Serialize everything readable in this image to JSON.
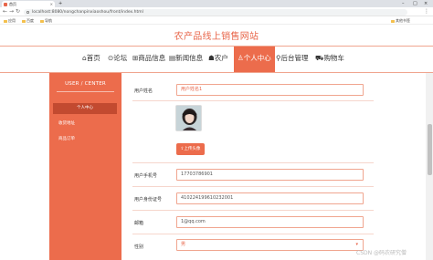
{
  "browser": {
    "tab_title": "首页",
    "url": "localhost:8080/nongchanpinxiaoshou/front/index.html",
    "bookmarks": [
      "应用",
      "百度",
      "导航"
    ],
    "bookmarks_right": "其他书签"
  },
  "site": {
    "title": "农产品线上销售网站"
  },
  "nav": {
    "items": [
      "首页",
      "论坛",
      "商品信息",
      "新闻信息",
      "农户",
      "个人中心",
      "后台管理",
      "购物车"
    ],
    "active": "个人中心"
  },
  "sidebar": {
    "header": "USER / CENTER",
    "items": [
      "个人中心",
      "收货地址",
      "商品订单"
    ]
  },
  "form": {
    "username_label": "用户姓名",
    "username_placeholder": "用户姓名1",
    "upload_label": "上传头像",
    "phone_label": "用户手机号",
    "phone_value": "17703786901",
    "idcard_label": "用户身份证号",
    "idcard_value": "410224199610232001",
    "email_label": "邮箱",
    "email_value": "1@qq.com",
    "gender_label": "性别",
    "gender_value": "男"
  },
  "watermark": "CSDN @码农研究僧",
  "colors": {
    "accent": "#ec6c4c",
    "sidebar_active": "#c24a30",
    "border": "#f0a58f"
  }
}
